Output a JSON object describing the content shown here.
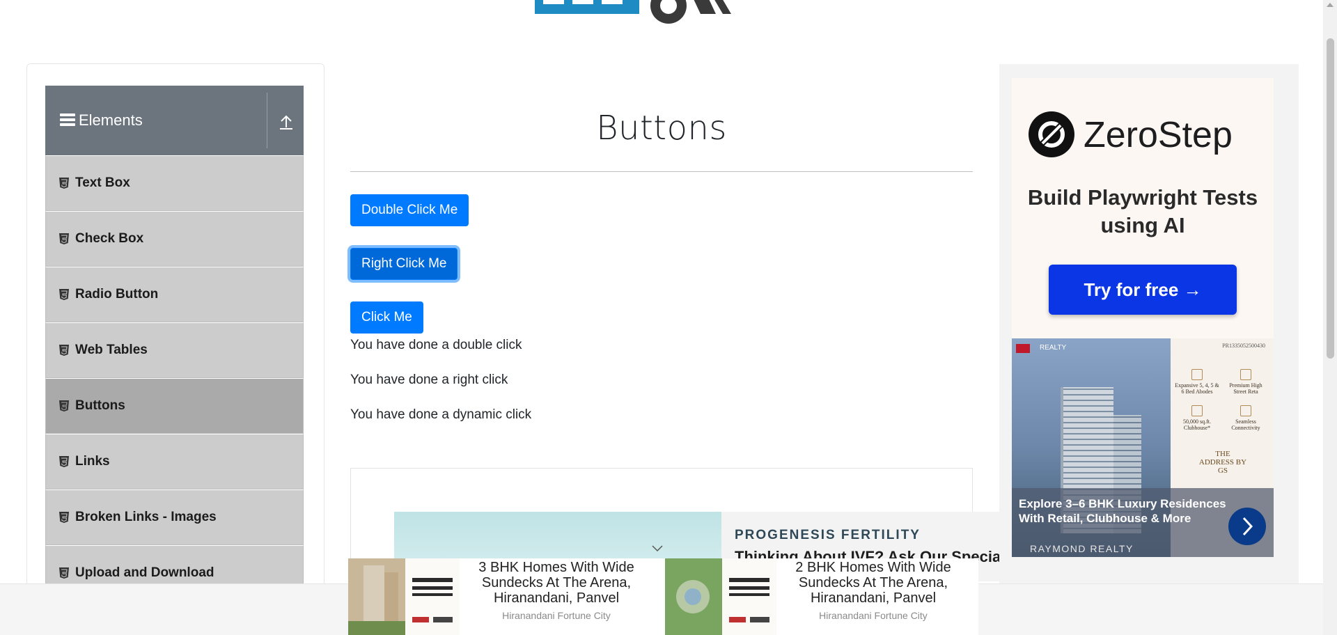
{
  "sidebar": {
    "group_title": "Elements",
    "items": [
      {
        "label": "Text Box"
      },
      {
        "label": "Check Box"
      },
      {
        "label": "Radio Button"
      },
      {
        "label": "Web Tables"
      },
      {
        "label": "Buttons"
      },
      {
        "label": "Links"
      },
      {
        "label": "Broken Links - Images"
      },
      {
        "label": "Upload and Download"
      }
    ],
    "active_item": "Buttons"
  },
  "main": {
    "title": "Buttons",
    "buttons": {
      "double_click": "Double Click Me",
      "right_click": "Right Click Me",
      "click": "Click Me"
    },
    "messages": {
      "double": "You have done a double click",
      "right": "You have done a right click",
      "dynamic": "You have done a dynamic click"
    }
  },
  "ads": {
    "inline": {
      "brand": "PROGENESIS FERTILITY",
      "headline": "Thinking About IVF? Ask Our Specia"
    },
    "right": {
      "zerostep_name": "ZeroStep",
      "zerostep_tagline": "Build Playwright Tests using AI",
      "zerostep_cta": "Try for free →",
      "realestate_text": "Explore 3–6 BHK Luxury Residences With Retail, Clubhouse & More",
      "realestate_brand": "RAYMOND REALTY",
      "realestate_logo": "REALTY",
      "realestate_reg": "PR1335052500430",
      "features": [
        {
          "label": "Expansive 5, 4, 5 & 6 Bed Abodes"
        },
        {
          "label": "Premium High Street Reta"
        },
        {
          "label": "50,000 sq.ft. Clubhouse*"
        },
        {
          "label": "Seamless Connectivity"
        }
      ],
      "address": "THE ADDRESS BY GS"
    },
    "bottom": [
      {
        "title": "3 BHK Homes With Wide Sundecks At The Arena, Hiranandani, Panvel",
        "source": "Hiranandani Fortune City"
      },
      {
        "title": "2 BHK Homes With Wide Sundecks At The Arena, Hiranandani, Panvel",
        "source": "Hiranandani Fortune City"
      }
    ]
  },
  "colors": {
    "primary": "#007bff",
    "sidebar_header": "#6c757d",
    "menu_item": "#cccccc",
    "menu_active": "#aaaaaa"
  }
}
